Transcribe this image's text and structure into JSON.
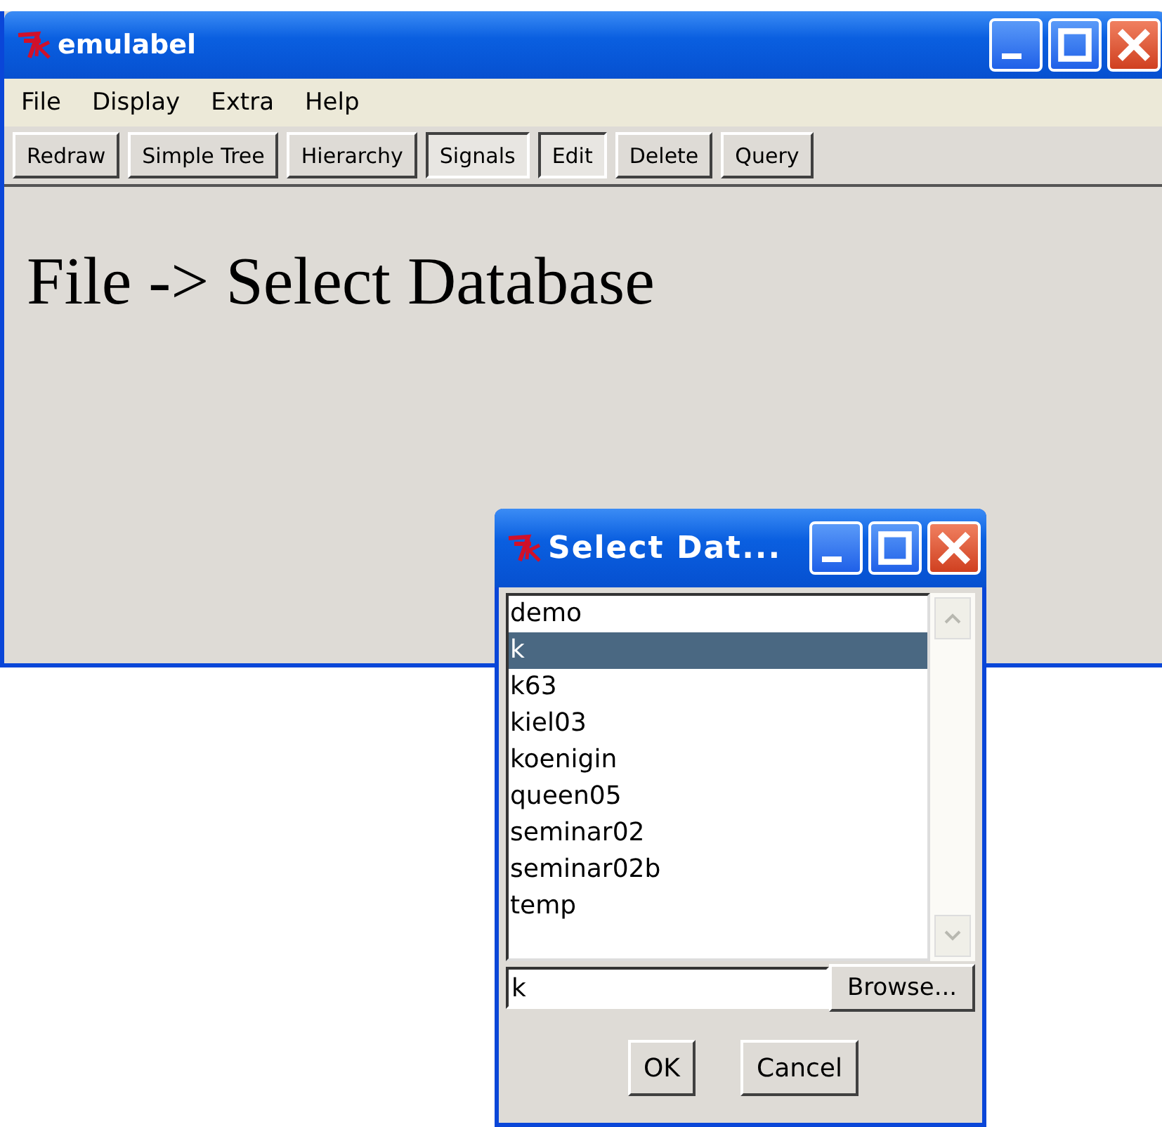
{
  "main_window": {
    "title": "emulabel",
    "menu": [
      "File",
      "Display",
      "Extra",
      "Help"
    ],
    "toolbar": [
      {
        "label": "Redraw",
        "pressed": false
      },
      {
        "label": "Simple Tree",
        "pressed": false
      },
      {
        "label": "Hierarchy",
        "pressed": false
      },
      {
        "label": "Signals",
        "pressed": true
      },
      {
        "label": "Edit",
        "pressed": true
      },
      {
        "label": "Delete",
        "pressed": false
      },
      {
        "label": "Query",
        "pressed": false
      }
    ],
    "message": "File -> Select Database"
  },
  "dialog": {
    "title": "Select Dat...",
    "items": [
      {
        "label": "demo",
        "selected": false
      },
      {
        "label": "k",
        "selected": true
      },
      {
        "label": "k63",
        "selected": false
      },
      {
        "label": "kiel03",
        "selected": false
      },
      {
        "label": "koenigin",
        "selected": false
      },
      {
        "label": "queen05",
        "selected": false
      },
      {
        "label": "seminar02",
        "selected": false
      },
      {
        "label": "seminar02b",
        "selected": false
      },
      {
        "label": "temp",
        "selected": false
      }
    ],
    "entry": {
      "value": "k"
    },
    "browse_button": "Browse...",
    "buttons": [
      "OK",
      "Cancel"
    ]
  }
}
